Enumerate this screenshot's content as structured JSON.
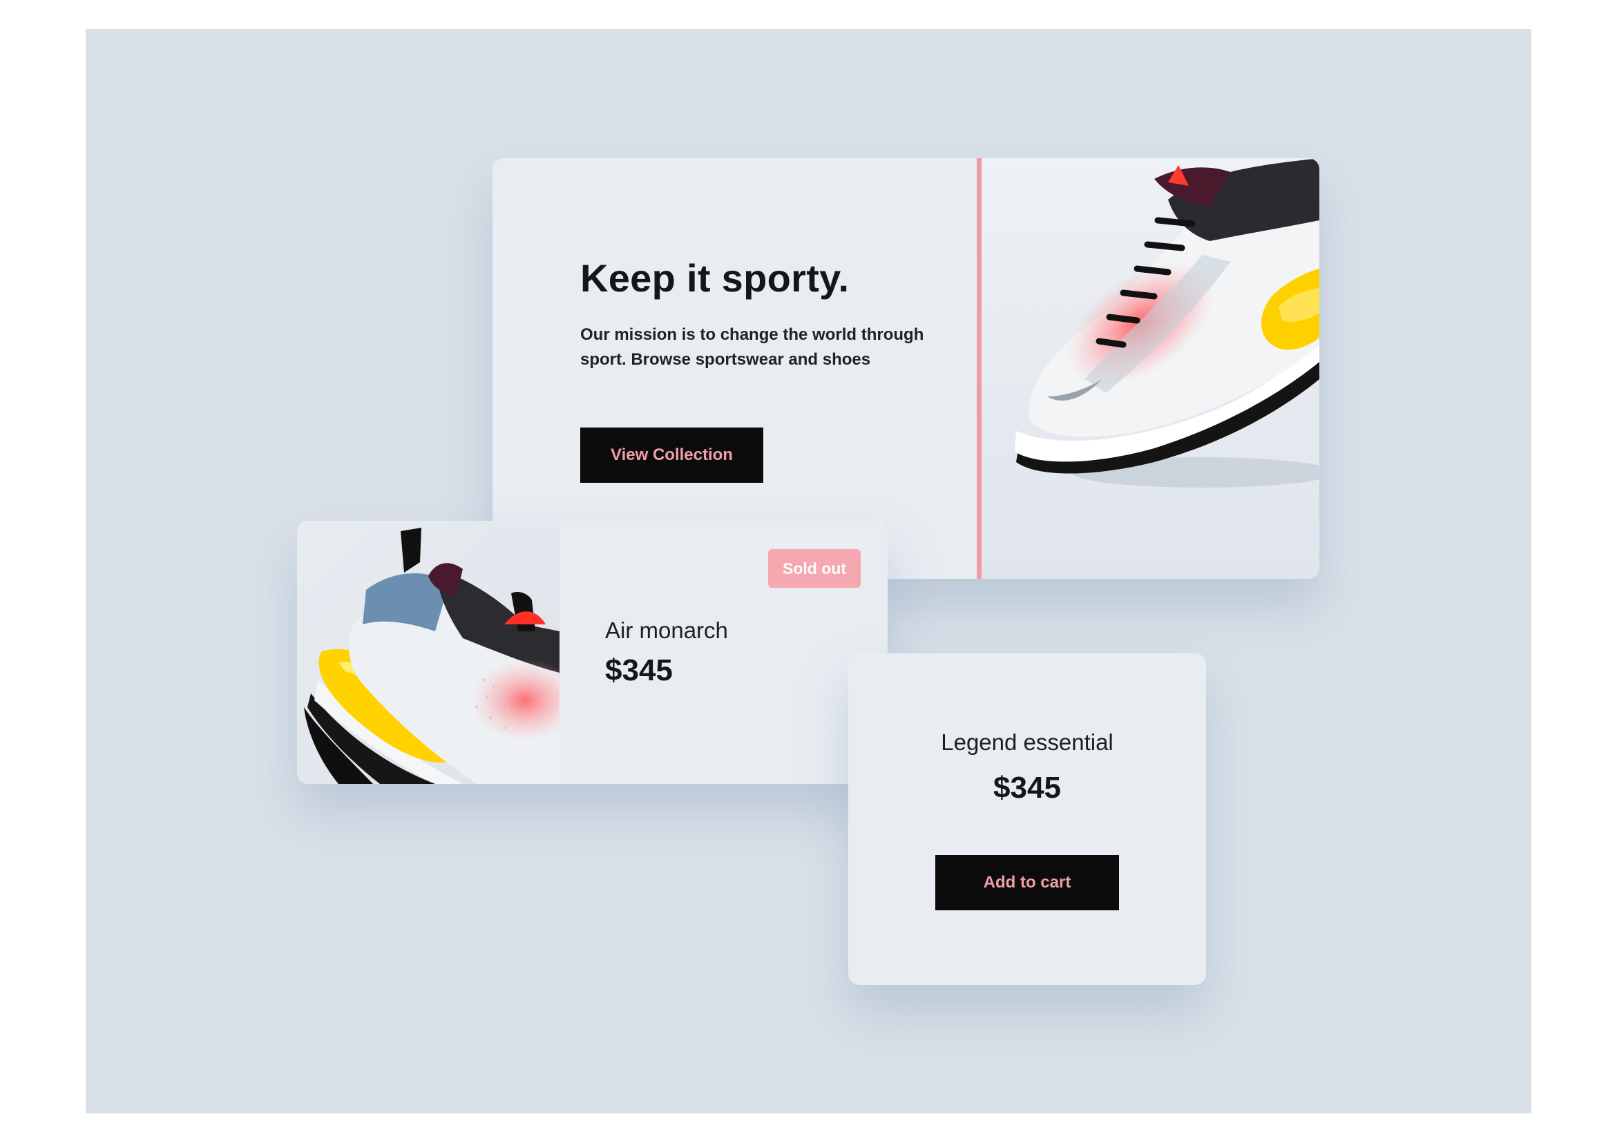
{
  "hero": {
    "title": "Keep it sporty.",
    "text": "Our mission is to change the world through sport. Browse sportswear and shoes",
    "button_label": "View Collection",
    "image": "sneaker-photo"
  },
  "products": [
    {
      "name": "Air monarch",
      "price": "$345",
      "badge": "Sold out",
      "image": "sneaker-photo"
    },
    {
      "name": "Legend essential",
      "price": "$345",
      "button_label": "Add to cart"
    }
  ],
  "colors": {
    "background": "#d9e0e8",
    "card": "#e9edf2",
    "accent_pink": "#f09ba3",
    "button_bg": "#0b0b0c",
    "button_text": "#f0a0a6",
    "badge_bg": "#f6a8b0"
  }
}
